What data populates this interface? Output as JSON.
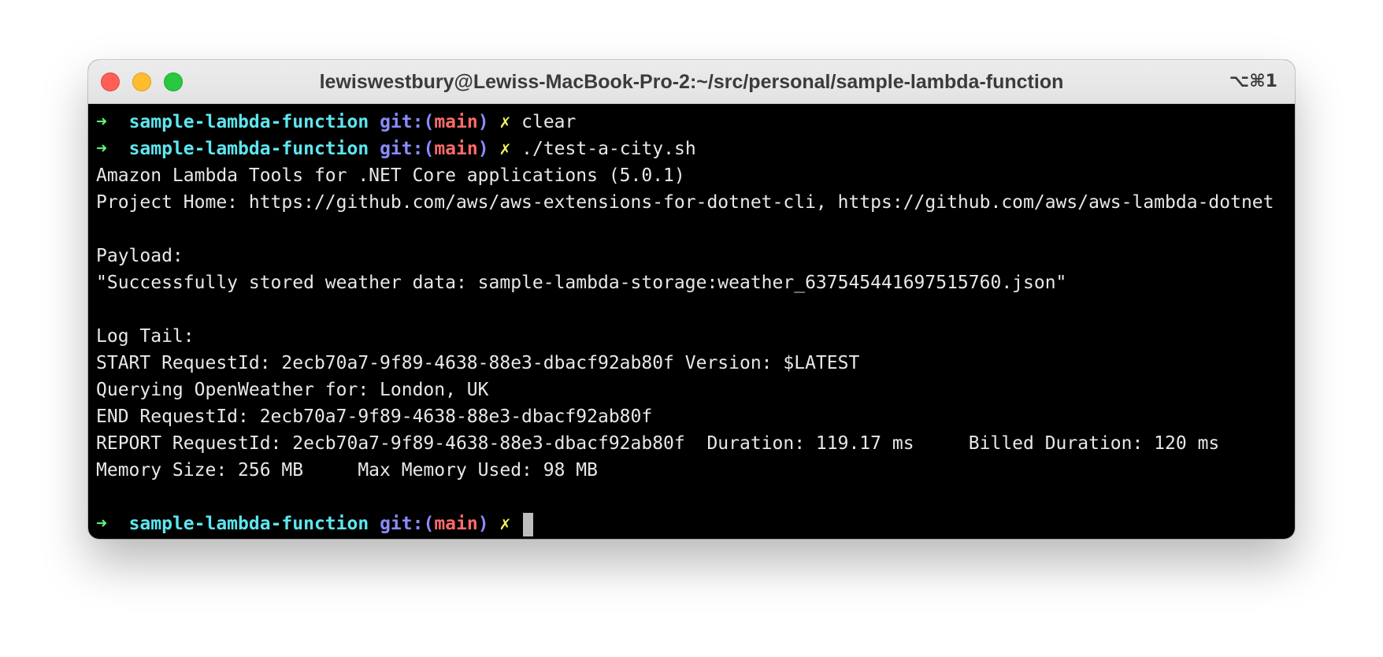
{
  "window": {
    "title": "lewiswestbury@Lewiss-MacBook-Pro-2:~/src/personal/sample-lambda-function",
    "shortcut": "⌥⌘1"
  },
  "prompt": {
    "arrow": "➜",
    "directory": "sample-lambda-function",
    "git_open": "git:(",
    "branch": "main",
    "git_close": ")",
    "dirty_mark": "✗"
  },
  "commands": [
    "clear",
    "./test-a-city.sh"
  ],
  "output": [
    "Amazon Lambda Tools for .NET Core applications (5.0.1)",
    "Project Home: https://github.com/aws/aws-extensions-for-dotnet-cli, https://github.com/aws/aws-lambda-dotnet",
    "",
    "Payload:",
    "\"Successfully stored weather data: sample-lambda-storage:weather_637545441697515760.json\"",
    "",
    "Log Tail:",
    "START RequestId: 2ecb70a7-9f89-4638-88e3-dbacf92ab80f Version: $LATEST",
    "Querying OpenWeather for: London, UK",
    "END RequestId: 2ecb70a7-9f89-4638-88e3-dbacf92ab80f",
    "REPORT RequestId: 2ecb70a7-9f89-4638-88e3-dbacf92ab80f  Duration: 119.17 ms     Billed Duration: 120 ms",
    "Memory Size: 256 MB     Max Memory Used: 98 MB",
    ""
  ],
  "colors": {
    "arrow": "#5ff97d",
    "directory": "#5ee6f0",
    "git": "#8a8cff",
    "branch": "#ff6b6b",
    "dirty_mark": "#f4f35a",
    "background": "#000000"
  }
}
